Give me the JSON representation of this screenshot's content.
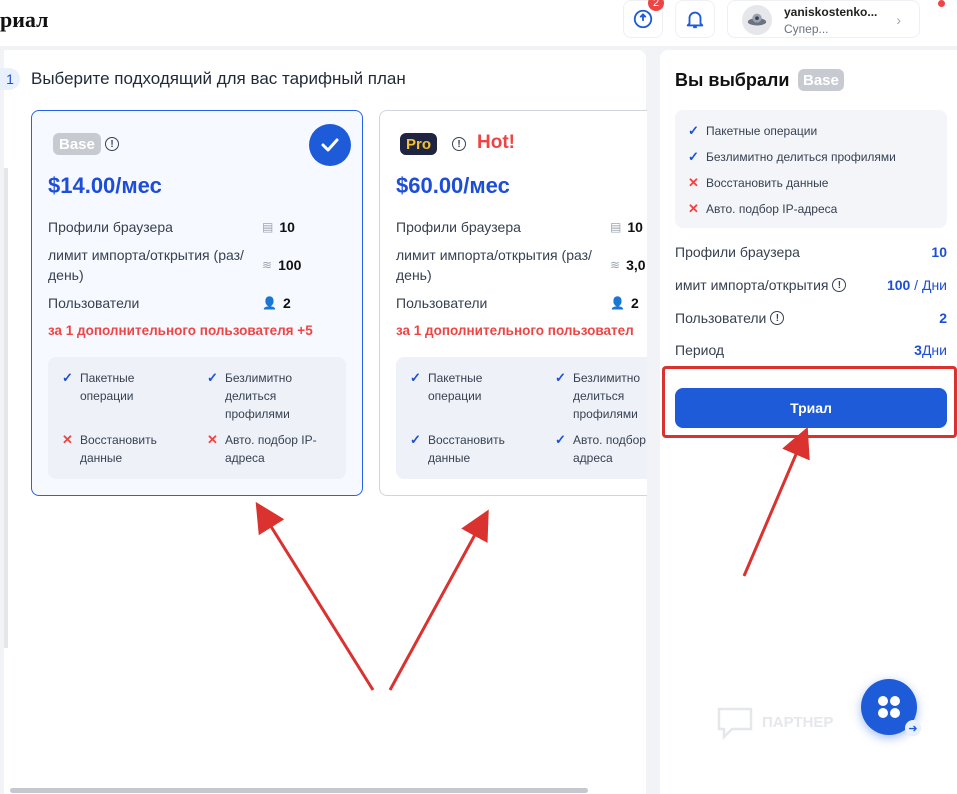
{
  "header": {
    "page_title": "риал",
    "updates_badge": "2",
    "user_name": "yaniskostenko...",
    "user_role": "Супер..."
  },
  "step": {
    "number": "1",
    "title": "Выберите подходящий для вас тарифный план"
  },
  "plans": [
    {
      "tag": "Base",
      "price": "$14.00/мес",
      "profiles_label": "Профили браузера",
      "profiles_value": "10",
      "import_label": "лимит импорта/открытия (раз/день)",
      "import_value": "100",
      "users_label": "Пользователи",
      "users_value": "2",
      "extra_user": "за 1 дополнительного пользователя +5",
      "features": [
        {
          "text": "Пакетные операции",
          "ok": true
        },
        {
          "text": "Безлимитно делиться профилями",
          "ok": true
        },
        {
          "text": "Восстановить данные",
          "ok": false
        },
        {
          "text": "Авто. подбор IP-адреса",
          "ok": false
        }
      ]
    },
    {
      "tag": "Pro",
      "hot": "Hot!",
      "price": "$60.00/мес",
      "profiles_label": "Профили браузера",
      "profiles_value": "10",
      "import_label": "лимит импорта/открытия (раз/день)",
      "import_value": "3,0",
      "users_label": "Пользователи",
      "users_value": "2",
      "extra_user": "за 1 дополнительного пользовател",
      "features": [
        {
          "text": "Пакетные операции",
          "ok": true
        },
        {
          "text": "Безлимитно делиться профилями",
          "ok": true
        },
        {
          "text": "Восстановить данные",
          "ok": true
        },
        {
          "text": "Авто. подбор IP-адреса",
          "ok": true
        }
      ]
    }
  ],
  "summary": {
    "title": "Вы выбрали",
    "tag": "Base",
    "features": [
      {
        "text": "Пакетные операции",
        "ok": true
      },
      {
        "text": "Безлимитно делиться профилями",
        "ok": true
      },
      {
        "text": "Восстановить данные",
        "ok": false
      },
      {
        "text": "Авто. подбор IP-адреса",
        "ok": false
      }
    ],
    "rows": [
      {
        "label": "Профили браузера",
        "value": "10",
        "unit": ""
      },
      {
        "label": "имит импорта/открытия",
        "value": "100",
        "unit": " / Дни"
      },
      {
        "label": "Пользователи",
        "value": "2",
        "unit": ""
      },
      {
        "label": "Период",
        "value": "3",
        "unit": "Дни"
      }
    ],
    "trial_button": "Триал"
  },
  "watermark": "ПАРТНЕР",
  "colors": {
    "accent": "#1d5bd8",
    "danger": "#ef4444",
    "annotation": "#d9322f",
    "pro_tag_bg": "#1f2540",
    "pro_tag_text": "#f6c232"
  }
}
